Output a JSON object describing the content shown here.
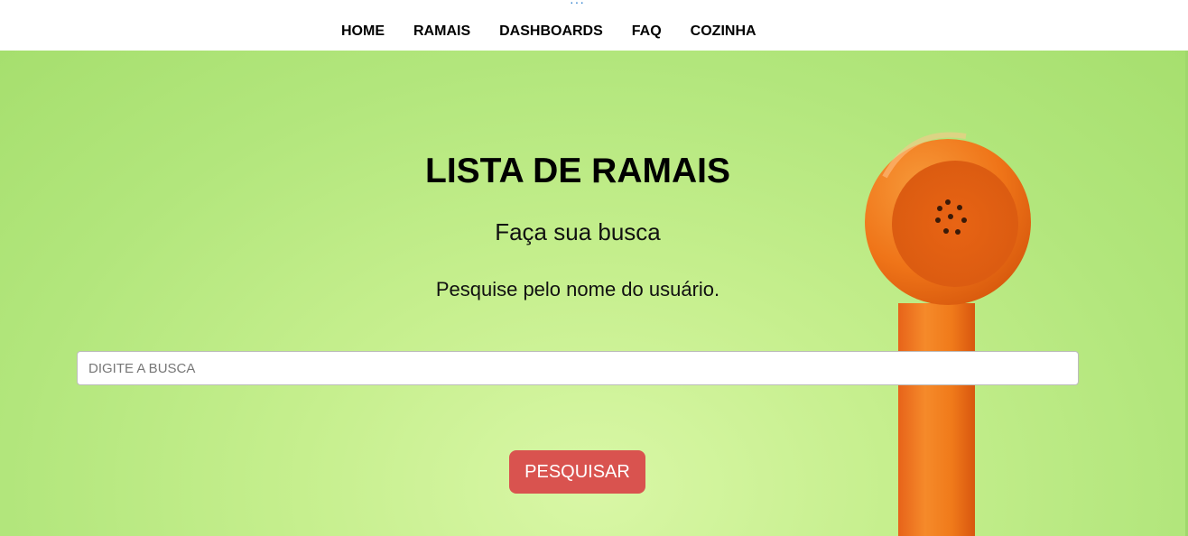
{
  "nav": {
    "dots": "···",
    "items": [
      {
        "label": "HOME"
      },
      {
        "label": "RAMAIS"
      },
      {
        "label": "DASHBOARDS"
      },
      {
        "label": "FAQ"
      },
      {
        "label": "COZINHA"
      }
    ]
  },
  "hero": {
    "title": "LISTA DE RAMAIS",
    "subtitle": "Faça sua busca",
    "hint": "Pesquise pelo nome do usuário."
  },
  "search": {
    "placeholder": "DIGITE A BUSCA",
    "value": "",
    "button_label": "PESQUISAR"
  },
  "colors": {
    "button": "#d9534f",
    "background": "#c6ef8e",
    "phone": "#f07a1a"
  },
  "icons": {
    "background_image": "orange-telephone-handset"
  }
}
